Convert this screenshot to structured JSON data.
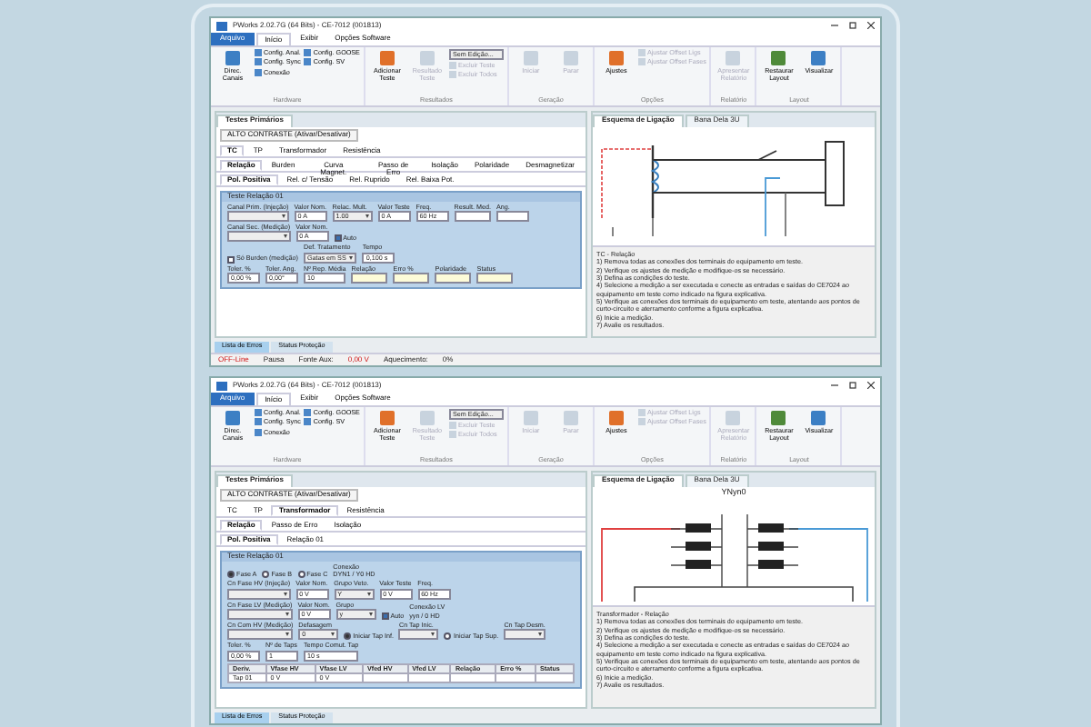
{
  "windows": [
    {
      "title": "PWorks 2.02.7G (64 Bits) - CE-7012 (001813)",
      "file_button": "Arquivo",
      "menu": [
        {
          "label": "Início",
          "selected": true
        },
        {
          "label": "Exibir",
          "selected": false
        },
        {
          "label": "Opções Software",
          "selected": false
        }
      ],
      "ribbon": [
        {
          "label": "Hardware",
          "buttons": [
            {
              "label": "Direc. Canais",
              "kind": "big"
            },
            {
              "label": "Config. Anal.",
              "kind": "small"
            },
            {
              "label": "Config. Sync",
              "kind": "small"
            },
            {
              "label": "Conexão",
              "kind": "small"
            },
            {
              "label": "Config. GOOSE",
              "kind": "small"
            },
            {
              "label": "Config. SV",
              "kind": "small"
            }
          ]
        },
        {
          "label": "Resultados",
          "buttons": [
            {
              "label": "Adicionar Teste",
              "kind": "big"
            },
            {
              "label": "Resultado Teste",
              "kind": "big",
              "disabled": true
            },
            {
              "label": "Sem Edição...",
              "kind": "combo"
            },
            {
              "label": "Excluir Teste",
              "kind": "small",
              "disabled": true
            },
            {
              "label": "Excluir Todos",
              "kind": "small",
              "disabled": true
            }
          ]
        },
        {
          "label": "Geração",
          "buttons": [
            {
              "label": "Iniciar",
              "kind": "big",
              "disabled": true
            },
            {
              "label": "Parar",
              "kind": "big",
              "disabled": true
            }
          ]
        },
        {
          "label": "Opções",
          "buttons": [
            {
              "label": "Ajustes",
              "kind": "big"
            },
            {
              "label": "Ajustar Offset Ligs",
              "kind": "small",
              "disabled": true
            },
            {
              "label": "Ajustar Offset Fases",
              "kind": "small",
              "disabled": true
            }
          ]
        },
        {
          "label": "Relatório",
          "buttons": [
            {
              "label": "Apresentar Relatório",
              "kind": "big",
              "disabled": true
            }
          ]
        },
        {
          "label": "Layout",
          "buttons": [
            {
              "label": "Restaurar Layout",
              "kind": "big"
            },
            {
              "label": "Visualizar",
              "kind": "big"
            }
          ]
        }
      ],
      "left": {
        "panel_tab": "Testes Primários",
        "contrast": "ALTO CONTRASTE (Ativar/Desativar)",
        "tab_rows": [
          [
            {
              "label": "TC",
              "selected": true
            },
            {
              "label": "TP",
              "selected": false
            },
            {
              "label": "Transformador",
              "selected": false
            },
            {
              "label": "Resistência",
              "selected": false
            }
          ],
          [
            {
              "label": "Relação",
              "selected": true
            },
            {
              "label": "Burden",
              "selected": false
            },
            {
              "label": "Curva Magnet.",
              "selected": false
            },
            {
              "label": "Passo de Erro",
              "selected": false
            },
            {
              "label": "Isolação",
              "selected": false
            },
            {
              "label": "Polaridade",
              "selected": false
            },
            {
              "label": "Desmagnetizar",
              "selected": false
            }
          ],
          [
            {
              "label": "Pol. Positiva",
              "selected": true
            },
            {
              "label": "Rel. c/ Tensão",
              "selected": false
            },
            {
              "label": "Rel. Ruprido",
              "selected": false
            },
            {
              "label": "Rel. Baixa Pot.",
              "selected": false
            }
          ]
        ],
        "group": "Teste Relação 01",
        "form": [
          [
            {
              "label": "Canal Prim. (Injeção)",
              "kind": "select"
            },
            {
              "label": "Valor Nom.",
              "value": "0 A",
              "kind": "input"
            },
            {
              "label": "Relac. Mult.",
              "value": "1.00",
              "kind": "select"
            },
            {
              "label": "Valor Teste",
              "value": "0 A",
              "kind": "input"
            },
            {
              "label": "Freq.",
              "value": "60 Hz",
              "kind": "input"
            },
            {
              "label": "Result. Med.",
              "kind": "input"
            },
            {
              "label": "Ang.",
              "kind": "input"
            }
          ],
          [
            {
              "label": "Canal Sec. (Medição)",
              "kind": "select"
            },
            {
              "label": "Valor Nom.",
              "value": "0 A",
              "kind": "input"
            },
            {
              "label": "Auto",
              "kind": "check",
              "checked": true
            }
          ],
          [
            {
              "label": "Só Burden (medição)",
              "kind": "check",
              "checked": false
            },
            {
              "label": "Def. Tratamento",
              "value": "Gatas em SS",
              "kind": "select"
            },
            {
              "label": "Tempo",
              "value": "0,100 s",
              "kind": "input"
            }
          ],
          [
            {
              "label": "Toler. %",
              "value": "0,00 %",
              "kind": "input"
            },
            {
              "label": "Toler. Ang.",
              "value": "0,00°",
              "kind": "input"
            },
            {
              "label": "Nº Rep. Média",
              "value": "10",
              "kind": "input"
            },
            {
              "label": "Relação",
              "kind": "result"
            },
            {
              "label": "Erro %",
              "kind": "result"
            },
            {
              "label": "Polaridade",
              "kind": "result"
            },
            {
              "label": "Status",
              "kind": "result"
            }
          ]
        ]
      },
      "right": {
        "tabs": [
          {
            "label": "Esquema de Ligação",
            "selected": true
          },
          {
            "label": "Bana Dela 3U",
            "selected": false
          }
        ],
        "diagram": {
          "kind": "ct"
        },
        "heading": "TC - Relação",
        "steps": [
          "1) Remova todas as conexões dos terminais do equipamento em teste.",
          "2) Verifique os ajustes de medição e modifique-os se necessário.",
          "3) Defina as condições do teste.",
          "4) Selecione a medição a ser executada e conecte as entradas e saídas do CE7024 ao equipamento em teste como indicado na figura explicativa.",
          "5) Verifique as conexões dos terminais do equipamento em teste, atentando aos pontos de curto-circuito e aterramento conforme a figura explicativa.",
          "6) Inicie a medição.",
          "7) Avalie os resultados."
        ]
      },
      "bottom_tabs": [
        {
          "label": "Lista de Erros",
          "selected": true
        },
        {
          "label": "Status Proteção",
          "selected": false
        }
      ],
      "status_bar": [
        {
          "label": "OFF-Line",
          "kind": "alert"
        },
        {
          "label": "Pausa",
          "kind": "plain"
        },
        {
          "label": "Fonte Aux:",
          "kind": "plain"
        },
        {
          "label": "0,00 V",
          "kind": "alert"
        },
        {
          "label": "Aquecimento:",
          "kind": "plain"
        },
        {
          "label": "0%",
          "kind": "plain"
        }
      ]
    },
    {
      "title": "PWorks 2.02.7G (64 Bits) - CE-7012 (001813)",
      "file_button": "Arquivo",
      "menu": [
        {
          "label": "Início",
          "selected": true
        },
        {
          "label": "Exibir",
          "selected": false
        },
        {
          "label": "Opções Software",
          "selected": false
        }
      ],
      "ribbon": [
        {
          "label": "Hardware",
          "buttons": [
            {
              "label": "Direc. Canais",
              "kind": "big"
            },
            {
              "label": "Config. Anal.",
              "kind": "small"
            },
            {
              "label": "Config. Sync",
              "kind": "small"
            },
            {
              "label": "Conexão",
              "kind": "small"
            },
            {
              "label": "Config. GOOSE",
              "kind": "small"
            },
            {
              "label": "Config. SV",
              "kind": "small"
            }
          ]
        },
        {
          "label": "Resultados",
          "buttons": [
            {
              "label": "Adicionar Teste",
              "kind": "big"
            },
            {
              "label": "Resultado Teste",
              "kind": "big",
              "disabled": true
            },
            {
              "label": "Sem Edição...",
              "kind": "combo"
            },
            {
              "label": "Excluir Teste",
              "kind": "small",
              "disabled": true
            },
            {
              "label": "Excluir Todos",
              "kind": "small",
              "disabled": true
            }
          ]
        },
        {
          "label": "Geração",
          "buttons": [
            {
              "label": "Iniciar",
              "kind": "big",
              "disabled": true
            },
            {
              "label": "Parar",
              "kind": "big",
              "disabled": true
            }
          ]
        },
        {
          "label": "Opções",
          "buttons": [
            {
              "label": "Ajustes",
              "kind": "big"
            },
            {
              "label": "Ajustar Offset Ligs",
              "kind": "small",
              "disabled": true
            },
            {
              "label": "Ajustar Offset Fases",
              "kind": "small",
              "disabled": true
            }
          ]
        },
        {
          "label": "Relatório",
          "buttons": [
            {
              "label": "Apresentar Relatório",
              "kind": "big",
              "disabled": true
            }
          ]
        },
        {
          "label": "Layout",
          "buttons": [
            {
              "label": "Restaurar Layout",
              "kind": "big"
            },
            {
              "label": "Visualizar",
              "kind": "big"
            }
          ]
        }
      ],
      "left": {
        "panel_tab": "Testes Primários",
        "contrast": "ALTO CONTRASTE (Ativar/Desativar)",
        "tab_rows": [
          [
            {
              "label": "TC",
              "selected": false
            },
            {
              "label": "TP",
              "selected": false
            },
            {
              "label": "Transformador",
              "selected": true
            },
            {
              "label": "Resistência",
              "selected": false
            }
          ],
          [
            {
              "label": "Relação",
              "selected": true
            },
            {
              "label": "Passo de Erro",
              "selected": false
            },
            {
              "label": "Isolação",
              "selected": false
            }
          ],
          [
            {
              "label": "Pol. Positiva",
              "selected": true
            },
            {
              "label": "Relação 01",
              "selected": false
            }
          ]
        ],
        "group": "Teste Relação 01",
        "form": [
          [
            {
              "label": "Fase",
              "value": "A",
              "kind": "radio",
              "checked": true
            },
            {
              "label": "Fase",
              "value": "B",
              "kind": "radio",
              "checked": false
            },
            {
              "label": "Fase",
              "value": "C",
              "kind": "radio",
              "checked": false
            },
            {
              "label": "Conexão",
              "value": "DYN1 / Y0 HD",
              "kind": "text"
            }
          ],
          [
            {
              "label": "Cn Fase HV (Injeção)",
              "kind": "select"
            },
            {
              "label": "Valor Nom.",
              "value": "0 V",
              "kind": "input"
            },
            {
              "label": "Grupo Veto.",
              "value": "Y",
              "kind": "select"
            },
            {
              "label": "Valor Teste",
              "value": "0 V",
              "kind": "input"
            },
            {
              "label": "Freq.",
              "value": "60 Hz",
              "kind": "input"
            }
          ],
          [
            {
              "label": "Cn Fase LV (Medição)",
              "kind": "select"
            },
            {
              "label": "Valor Nom.",
              "value": "0 V",
              "kind": "input"
            },
            {
              "label": "Grupo",
              "value": "y",
              "kind": "select"
            },
            {
              "label": "Auto",
              "kind": "check",
              "checked": true
            },
            {
              "label": "Conexão LV",
              "value": "yyn / 0 HD",
              "kind": "text"
            }
          ],
          [
            {
              "label": "Cn Com HV (Medição)",
              "kind": "select"
            },
            {
              "label": "Defasagem",
              "value": "0",
              "kind": "select"
            },
            {
              "label": "Iniciar Tap Inf.",
              "kind": "radio",
              "checked": true
            },
            {
              "label": "Cn Tap Inic.",
              "kind": "select"
            },
            {
              "label": "Iniciar Tap Sup.",
              "kind": "radio",
              "checked": false
            },
            {
              "label": "Cn Tap Desm.",
              "kind": "select"
            }
          ],
          [
            {
              "label": "Toler. %",
              "value": "0,00 %",
              "kind": "input"
            },
            {
              "label": "Nº de Taps",
              "value": "1",
              "kind": "input"
            },
            {
              "label": "Tempo Comut. Tap",
              "value": "10 s",
              "kind": "input"
            }
          ]
        ],
        "table": {
          "columns": [
            "Deriv.",
            "Vfase HV",
            "Vfase LV",
            "Vfed HV",
            "Vfed LV",
            "Relação",
            "Erro %",
            "Status"
          ],
          "rows": [
            [
              "Tap 01",
              "0 V",
              "0 V",
              "",
              "",
              "",
              "",
              ""
            ]
          ]
        }
      },
      "right": {
        "tabs": [
          {
            "label": "Esquema de Ligação",
            "selected": true
          },
          {
            "label": "Bana Dela 3U",
            "selected": false
          }
        ],
        "diagram": {
          "kind": "transformer",
          "title": "YNyn0"
        },
        "heading": "Transformador - Relação",
        "steps": [
          "1) Remova todas as conexões dos terminais do equipamento em teste.",
          "2) Verifique os ajustes de medição e modifique-os se necessário.",
          "3) Defina as condições do teste.",
          "4) Selecione a medição a ser executada e conecte as entradas e saídas do CE7024 ao equipamento em teste como indicado na figura explicativa.",
          "5) Verifique as conexões dos terminais do equipamento em teste, atentando aos pontos de curto-circuito e aterramento conforme a figura explicativa.",
          "6) Inicie a medição.",
          "7) Avalie os resultados."
        ]
      },
      "bottom_tabs": [
        {
          "label": "Lista de Erros",
          "selected": true
        },
        {
          "label": "Status Proteção",
          "selected": false
        }
      ]
    }
  ]
}
